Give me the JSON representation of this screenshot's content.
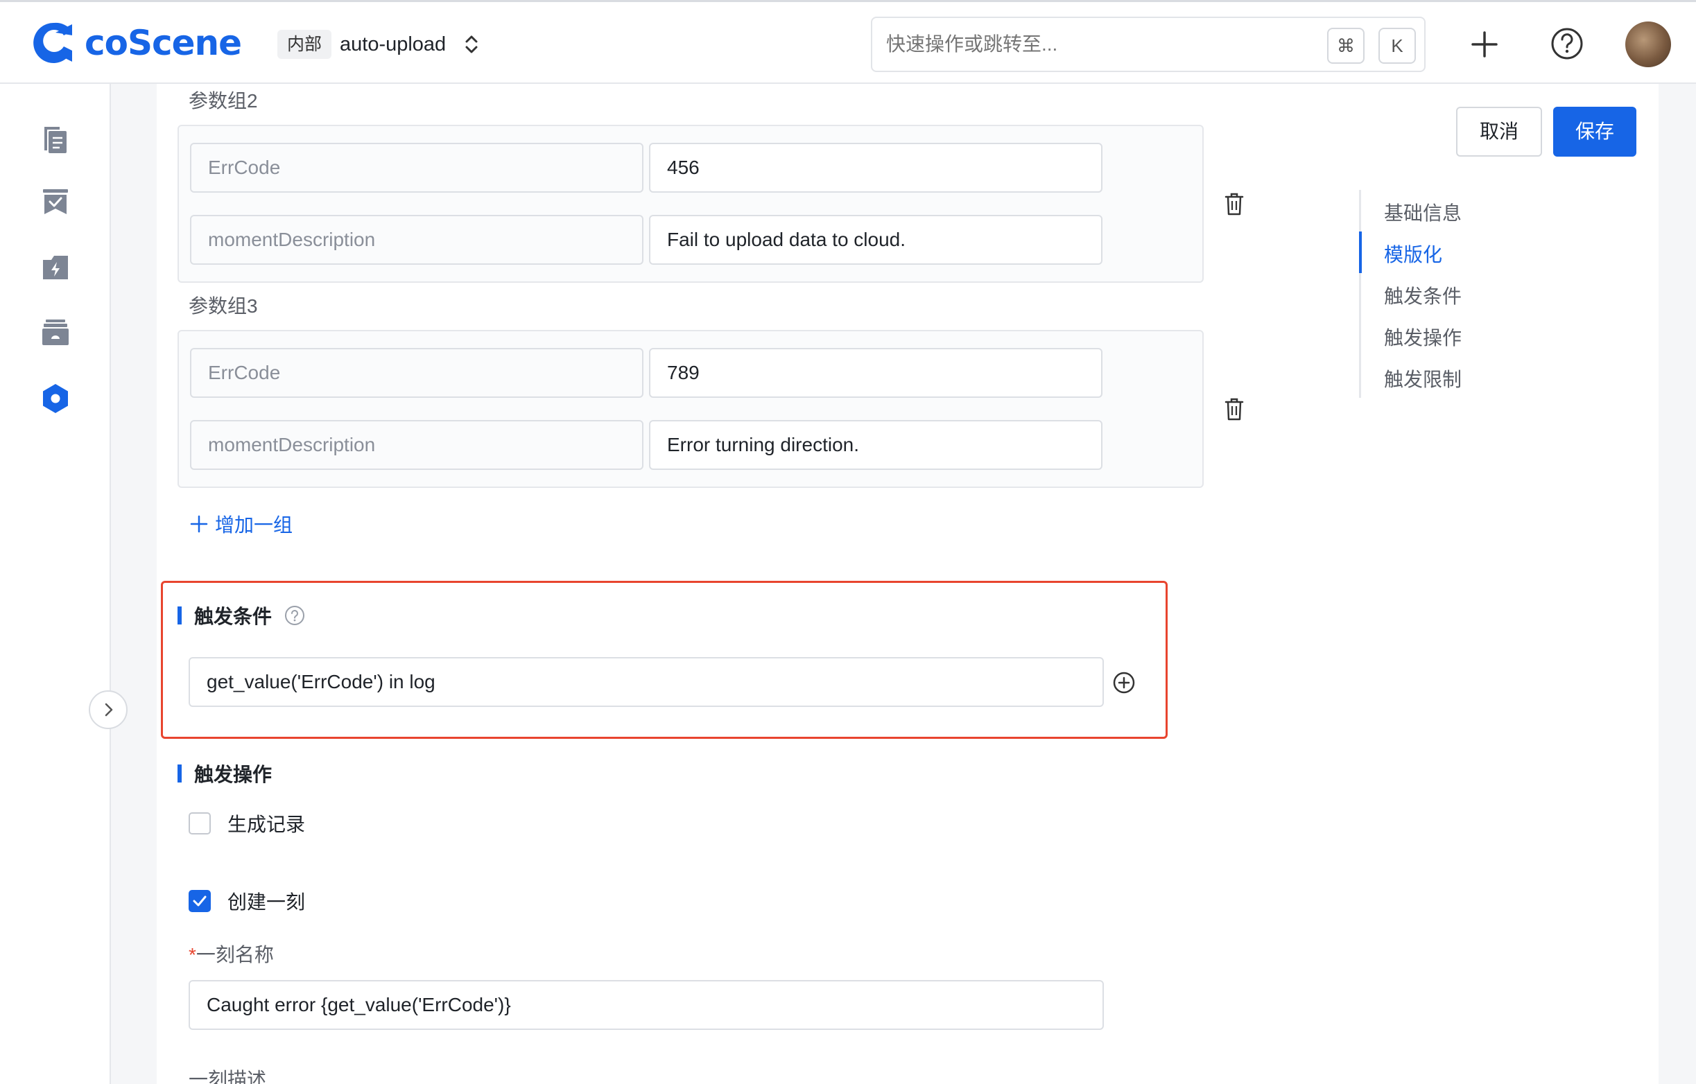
{
  "header": {
    "logo_text": "coScene",
    "org_badge": "内部",
    "project_name": "auto-upload",
    "search_placeholder": "快速操作或跳转至...",
    "shortcut_cmd": "⌘",
    "shortcut_key": "K",
    "brand_color": "#1765e6"
  },
  "sidebar": {
    "items": [
      {
        "icon": "records-icon"
      },
      {
        "icon": "tasks-icon"
      },
      {
        "icon": "actions-icon"
      },
      {
        "icon": "devices-icon"
      },
      {
        "icon": "settings-hex-icon"
      }
    ]
  },
  "groups": [
    {
      "label": "参数组2",
      "rows": [
        {
          "key": "ErrCode",
          "value": "456"
        },
        {
          "key": "momentDescription",
          "value": "Fail to upload data to cloud."
        }
      ]
    },
    {
      "label": "参数组3",
      "rows": [
        {
          "key": "ErrCode",
          "value": "789"
        },
        {
          "key": "momentDescription",
          "value": "Error turning direction."
        }
      ]
    }
  ],
  "add_group_label": "增加一组",
  "trigger_condition": {
    "title": "触发条件",
    "value": "get_value('ErrCode') in log"
  },
  "trigger_action": {
    "title": "触发操作",
    "generate_record": {
      "label": "生成记录",
      "checked": false
    },
    "create_moment": {
      "label": "创建一刻",
      "checked": true
    },
    "moment_name_label": "一刻名称",
    "moment_name_required": "*",
    "moment_name_value": "Caught error {get_value('ErrCode')}",
    "moment_desc_label": "一刻描述"
  },
  "actions": {
    "cancel": "取消",
    "save": "保存"
  },
  "anchors": [
    {
      "label": "基础信息",
      "active": false
    },
    {
      "label": "模版化",
      "active": true
    },
    {
      "label": "触发条件",
      "active": false
    },
    {
      "label": "触发操作",
      "active": false
    },
    {
      "label": "触发限制",
      "active": false
    }
  ]
}
